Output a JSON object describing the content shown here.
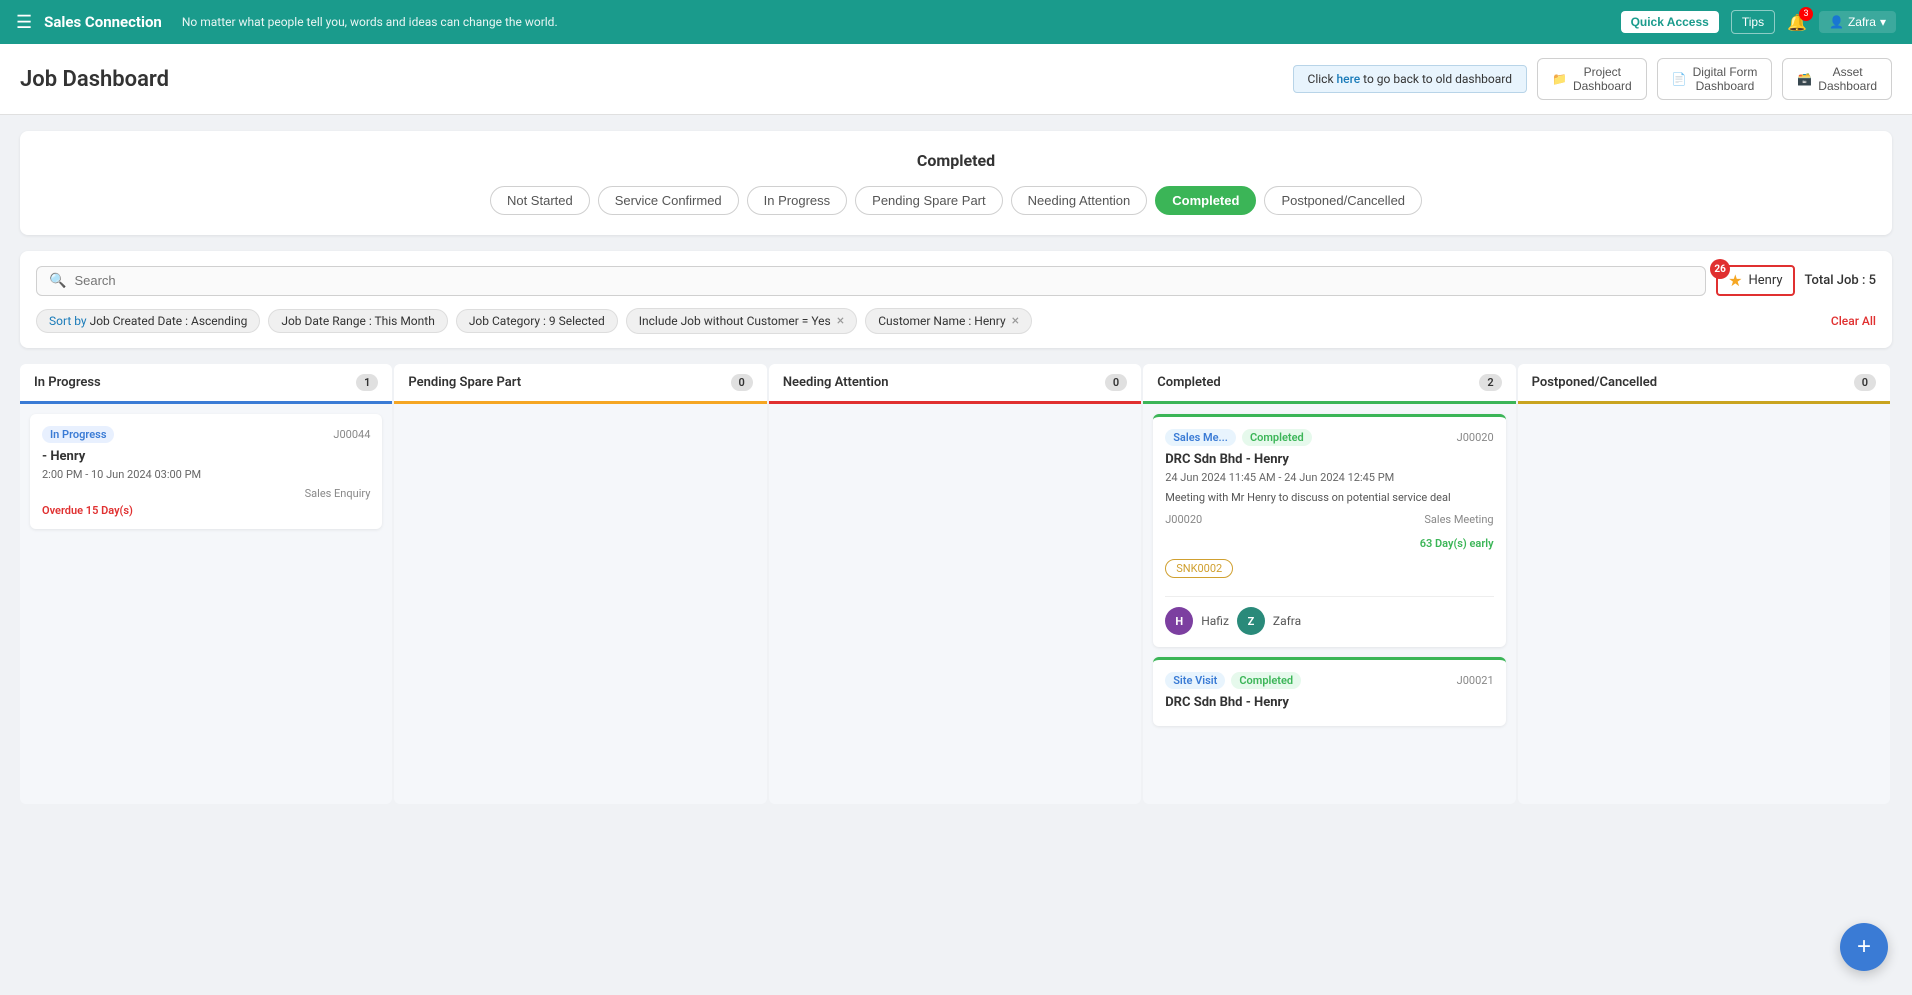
{
  "topNav": {
    "hamburger": "☰",
    "brand": "Sales Connection",
    "tagline": "No matter what people tell you, words and ideas can change the world.",
    "quickAccess": "Quick Access",
    "tips": "Tips",
    "notifBadge": "3",
    "user": "Zafra",
    "chevron": "▾"
  },
  "header": {
    "title": "Job Dashboard",
    "oldDashboardText": "Click",
    "oldDashboardLink": "here",
    "oldDashboardSuffix": " to go back to old dashboard",
    "navButtons": [
      {
        "id": "project-dashboard",
        "icon": "📁",
        "label": "Project Dashboard"
      },
      {
        "id": "digital-form-dashboard",
        "icon": "📄",
        "label": "Digital Form Dashboard"
      },
      {
        "id": "asset-dashboard",
        "icon": "🗃️",
        "label": "Asset Dashboard"
      }
    ]
  },
  "statusCard": {
    "title": "Completed",
    "tabs": [
      {
        "id": "not-started",
        "label": "Not Started",
        "active": false
      },
      {
        "id": "service-confirmed",
        "label": "Service Confirmed",
        "active": false
      },
      {
        "id": "in-progress",
        "label": "In Progress",
        "active": false
      },
      {
        "id": "pending-spare-part",
        "label": "Pending Spare Part",
        "active": false
      },
      {
        "id": "needing-attention",
        "label": "Needing Attention",
        "active": false
      },
      {
        "id": "completed",
        "label": "Completed",
        "active": true
      },
      {
        "id": "postponed-cancelled",
        "label": "Postponed/Cancelled",
        "active": false
      }
    ]
  },
  "filterBar": {
    "searchPlaceholder": "Search",
    "starredCount": "26",
    "starredLabel": "Henry",
    "totalJob": "Total Job : 5",
    "filters": [
      {
        "id": "sort",
        "text": "Sort by Job Created Date : Ascending",
        "removable": false
      },
      {
        "id": "date-range",
        "text": "Job Date Range : This Month",
        "removable": false
      },
      {
        "id": "category",
        "text": "Job Category : 9 Selected",
        "removable": false
      },
      {
        "id": "include-without-customer",
        "text": "Include Job without Customer = Yes",
        "removable": true
      },
      {
        "id": "customer-name",
        "text": "Customer Name : Henry",
        "removable": true
      }
    ],
    "clearAll": "Clear All"
  },
  "kanban": {
    "columns": [
      {
        "id": "in-progress",
        "label": "In Progress",
        "colorClass": "blue",
        "count": "1",
        "cards": [
          {
            "id": "card-j00044",
            "statusBadge": "In Progress",
            "statusClass": "badge-inprogress",
            "jobId": "J00044",
            "customer": "- Henry",
            "time": "2:00 PM - 10 Jun 2024 03:00 PM",
            "desc": "",
            "category": "Sales Enquiry",
            "overdue": "Overdue 15 Day(s)",
            "early": "",
            "tag": "",
            "avatars": []
          }
        ]
      },
      {
        "id": "pending-spare-part",
        "label": "Pending Spare Part",
        "colorClass": "orange",
        "count": "0",
        "cards": []
      },
      {
        "id": "needing-attention",
        "label": "Needing Attention",
        "colorClass": "red",
        "count": "0",
        "cards": []
      },
      {
        "id": "completed",
        "label": "Completed",
        "colorClass": "green",
        "count": "2",
        "cards": [
          {
            "id": "card-j00020",
            "statusBadge": "Sales Me...",
            "statusBadge2": "Completed",
            "statusClass": "badge-completed",
            "jobId": "J00020",
            "customer": "DRC Sdn Bhd - Henry",
            "time": "24 Jun 2024 11:45 AM - 24 Jun 2024 12:45 PM",
            "desc": "Meeting with Mr Henry to discuss on potential service deal",
            "category": "Sales Meeting",
            "overdue": "",
            "early": "63 Day(s) early",
            "tag": "SNK0002",
            "jobMeta": "J00020",
            "avatars": [
              {
                "initial": "H",
                "name": "Hafiz",
                "colorClass": "avatar-purple"
              },
              {
                "initial": "Z",
                "name": "Zafra",
                "colorClass": "avatar-teal"
              }
            ]
          },
          {
            "id": "card-j00021",
            "statusBadge": "Site Visit",
            "statusBadge2": "Completed",
            "statusClass": "badge-completed",
            "jobId": "J00021",
            "customer": "DRC Sdn Bhd - Henry",
            "time": "",
            "desc": "",
            "category": "",
            "overdue": "",
            "early": "",
            "tag": "",
            "avatars": []
          }
        ]
      },
      {
        "id": "postponed-cancelled",
        "label": "Postponed/Cancelled",
        "colorClass": "gold",
        "count": "0",
        "cards": []
      }
    ]
  },
  "fab": {
    "icon": "+"
  }
}
